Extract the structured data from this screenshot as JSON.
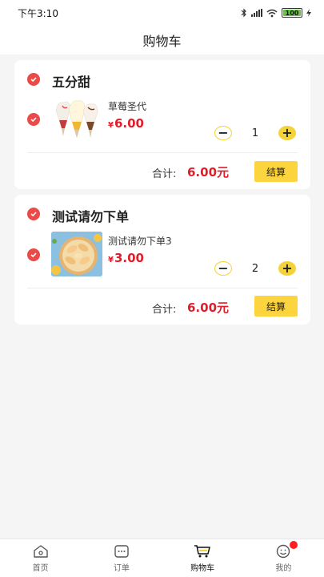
{
  "status_bar": {
    "time": "下午3:10",
    "battery": "100"
  },
  "nav": {
    "title": "购物车"
  },
  "carts": [
    {
      "shop_name": "五分甜",
      "product_name": "草莓圣代",
      "currency": "¥",
      "price": "6.00",
      "quantity": "1",
      "total_label": "合计:",
      "total_value": "6.00元",
      "checkout_label": "结算"
    },
    {
      "shop_name": "测试请勿下单",
      "product_name": "测试请勿下单3",
      "currency": "¥",
      "price": "3.00",
      "quantity": "2",
      "total_label": "合计:",
      "total_value": "6.00元",
      "checkout_label": "结算"
    }
  ],
  "stepper": {
    "minus": "−",
    "plus": "+"
  },
  "tabbar": {
    "items": [
      {
        "label": "首页",
        "icon": "home-icon"
      },
      {
        "label": "订单",
        "icon": "order-icon"
      },
      {
        "label": "购物车",
        "icon": "cart-icon"
      },
      {
        "label": "我的",
        "icon": "profile-icon"
      }
    ],
    "active_index": 2
  },
  "colors": {
    "accent": "#fcd53e",
    "price": "#e11d2a",
    "check": "#ea4a48"
  }
}
